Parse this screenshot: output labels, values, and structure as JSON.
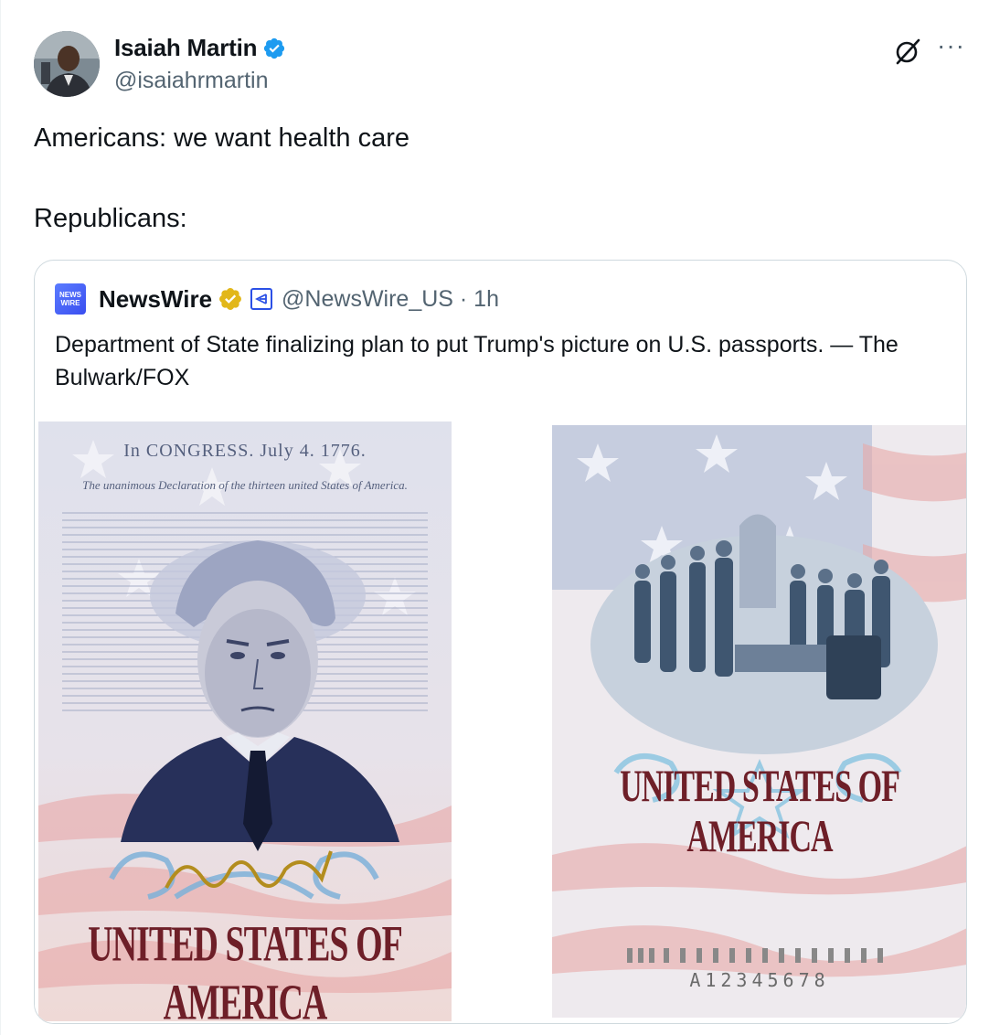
{
  "author": {
    "name": "Isaiah Martin",
    "handle": "@isaiahrmartin",
    "verified": true
  },
  "icons": {
    "verified": "verified-badge-icon",
    "grok": "grok-icon",
    "more": "more-icon",
    "gold_check": "gold-verified-badge-icon",
    "affiliate": "affiliate-badge-icon"
  },
  "more_label": "···",
  "tweet": {
    "line1": "Americans: we want health care",
    "line2": "Republicans:"
  },
  "quote": {
    "logo_line1": "NEWS",
    "logo_line2": "WIRE",
    "name": "NewsWire",
    "handle_time": "@NewsWire_US · 1h",
    "text": "Department of State finalizing plan to put Trump's picture on U.S. passports. — The Bulwark/FOX"
  },
  "media": {
    "left": {
      "header": "In CONGRESS. July 4. 1776.",
      "subheader": "The unanimous Declaration of the thirteen united States of America.",
      "caption": "UNITED STATES OF AMERICA"
    },
    "right": {
      "caption": "UNITED STATES OF AMERICA",
      "serial": "A12345678"
    }
  },
  "colors": {
    "accent_blue": "#1d9bf0",
    "gold": "#e2b719",
    "caption_red": "#6e1f28",
    "secondary_text": "#536471",
    "border": "#cfd9de"
  }
}
